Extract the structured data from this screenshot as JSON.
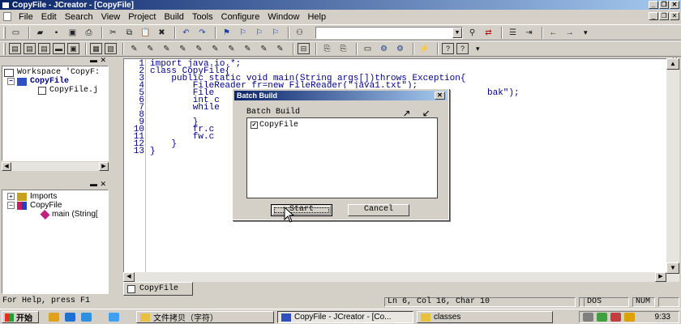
{
  "window": {
    "title": "CopyFile - JCreator - [CopyFile]"
  },
  "menu": {
    "items": [
      "File",
      "Edit",
      "Search",
      "View",
      "Project",
      "Build",
      "Tools",
      "Configure",
      "Window",
      "Help"
    ]
  },
  "workspace": {
    "root": "Workspace 'CopyF:",
    "project": "CopyFile",
    "file": "CopyFile.j"
  },
  "packages": {
    "imports": "Imports",
    "class": "CopyFile",
    "method": "main (String["
  },
  "editor": {
    "line_numbers": [
      "1",
      "2",
      "3",
      "4",
      "5",
      "6",
      "7",
      "8",
      "9",
      "10",
      "11",
      "12",
      "13"
    ],
    "lines": [
      "import java.io.*;",
      "class CopyFile{",
      "    public static void main(String args[])throws Exception{",
      "        FileReader fr=new FileReader(\"java1.txt\");",
      "        File",
      "        int c",
      "        while",
      "",
      "        }",
      "        fr.c",
      "        fw.c",
      "    }",
      "}"
    ],
    "line5_tail": "bak\");",
    "tab_label": "CopyFile"
  },
  "dialog": {
    "title": "Batch Build",
    "group_label": "Batch Build",
    "item": "CopyFile",
    "start_label": "Start",
    "cancel_label": "Cancel"
  },
  "status": {
    "help": "For Help, press F1",
    "position": "Ln 6, Col 16, Char 10",
    "dos": "DOS",
    "num": "NUM"
  },
  "taskbar": {
    "start_label": "开始",
    "tasks": [
      "文件拷贝（字符）",
      "CopyFile - JCreator - [Co...",
      "classes"
    ],
    "clock": "9:33"
  },
  "colors": {
    "titlebar": "#0a246a",
    "code_text": "#00008b",
    "line_numbers": "#000080"
  }
}
